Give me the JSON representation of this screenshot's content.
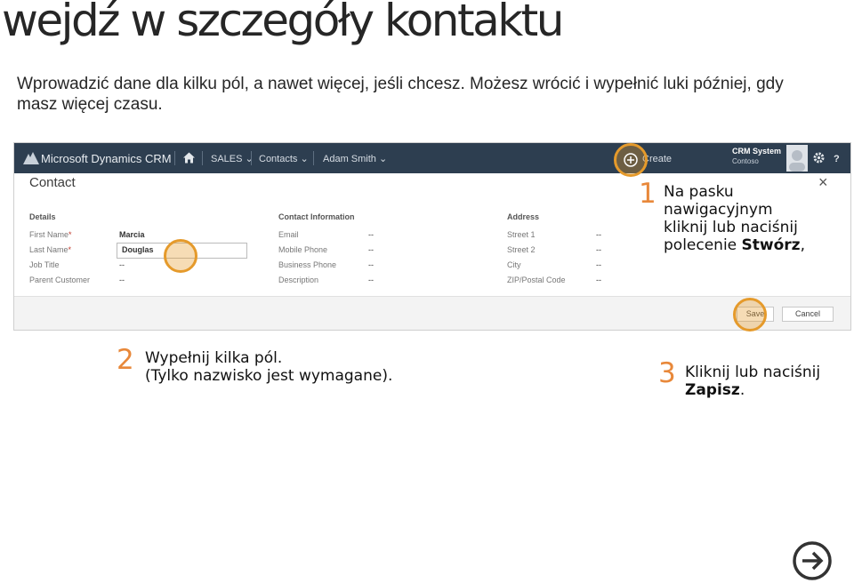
{
  "slide": {
    "title": "wejdź w szczegóły kontaktu",
    "intro": "Wprowadzić dane dla kilku pól, a nawet więcej, jeśli chcesz. Możesz wrócić i wypełnić luki później, gdy masz więcej czasu."
  },
  "crm": {
    "brand": "Microsoft Dynamics CRM",
    "nav": {
      "sales": "SALES",
      "contacts": "Contacts",
      "user": "Adam Smith",
      "create": "Create"
    },
    "user_panel": {
      "name": "CRM System",
      "org": "Contoso"
    },
    "form": {
      "title": "Contact",
      "details": {
        "heading": "Details",
        "rows": [
          {
            "label": "First Name",
            "required": "*",
            "value": "Marcia"
          },
          {
            "label": "Last Name",
            "required": "*",
            "value": "Douglas"
          },
          {
            "label": "Job Title",
            "value": "--"
          },
          {
            "label": "Parent Customer",
            "value": "--"
          }
        ]
      },
      "contact_info": {
        "heading": "Contact Information",
        "rows": [
          {
            "label": "Email",
            "value": "--"
          },
          {
            "label": "Mobile Phone",
            "value": "--"
          },
          {
            "label": "Business Phone",
            "value": "--"
          },
          {
            "label": "Description",
            "value": "--"
          }
        ]
      },
      "address": {
        "heading": "Address",
        "rows": [
          {
            "label": "Street 1",
            "value": "--"
          },
          {
            "label": "Street 2",
            "value": "--"
          },
          {
            "label": "City",
            "value": "--"
          },
          {
            "label": "ZIP/Postal Code",
            "value": "--"
          }
        ]
      },
      "save_label": "Save",
      "cancel_label": "Cancel"
    }
  },
  "steps": [
    {
      "number": "1",
      "line1": "Na pasku",
      "line2": "nawigacyjnym",
      "line3": "kliknij lub naciśnij",
      "line4_pre": "polecenie ",
      "line4_bold": "Stwórz",
      "line4_post": ","
    },
    {
      "number": "2",
      "line1": "Wypełnij kilka pól.",
      "line2": "(Tylko nazwisko jest wymagane)."
    },
    {
      "number": "3",
      "line1": "Kliknij lub naciśnij",
      "line2_bold": "Zapisz",
      "line2_post": "."
    }
  ],
  "colors": {
    "accent": "#e8883a",
    "highlight": "#e59a2b",
    "navbar": "#2d3e50"
  },
  "icons": {
    "home": "home-icon",
    "gear": "gear-icon",
    "help": "help-icon",
    "next": "next-arrow-icon"
  }
}
